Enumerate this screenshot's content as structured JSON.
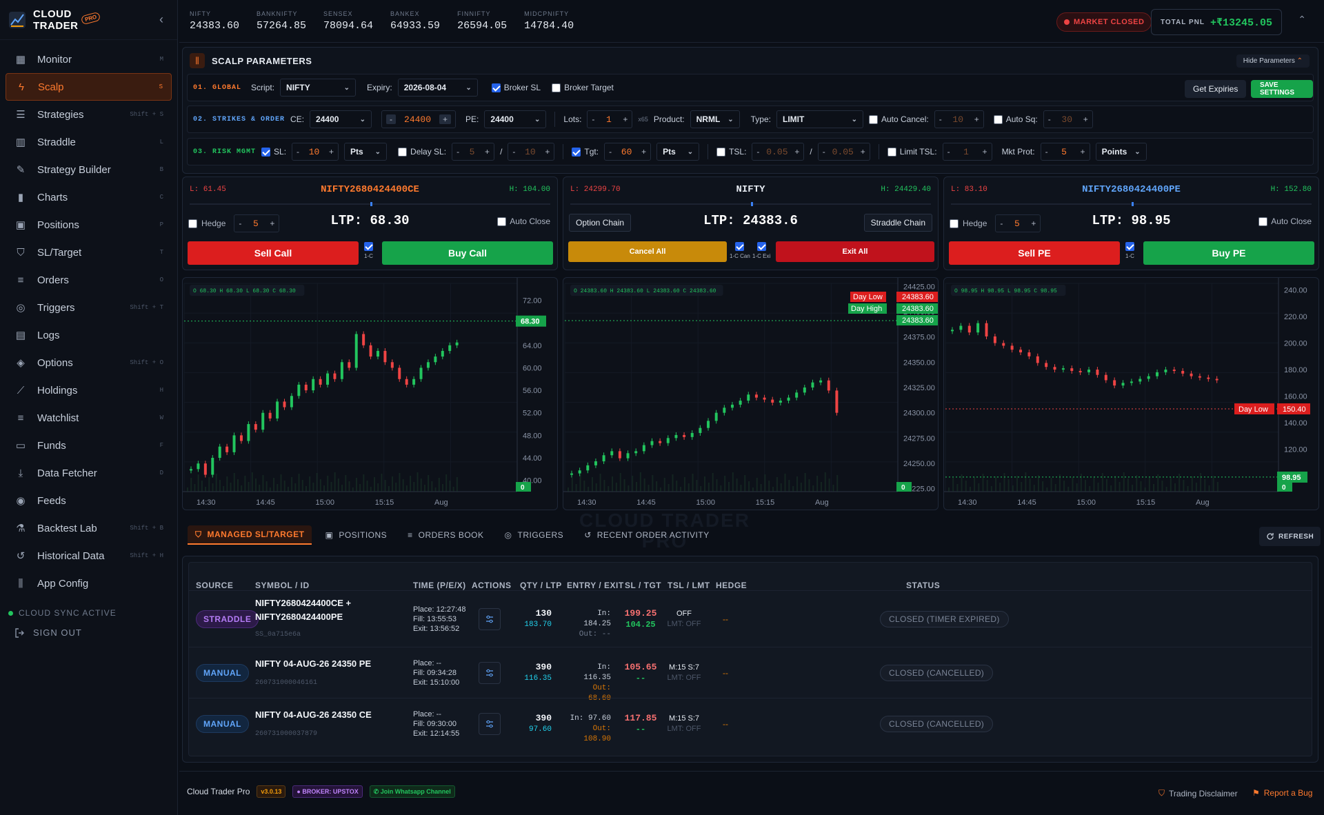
{
  "brand": {
    "name_line1": "CLOUD",
    "name_line2": "TRADER",
    "badge": "PRO"
  },
  "nav": [
    {
      "label": "Monitor",
      "shortcut": "M",
      "icon": "grid-icon"
    },
    {
      "label": "Scalp",
      "shortcut": "S",
      "icon": "bolt-icon",
      "active": true
    },
    {
      "label": "Strategies",
      "shortcut": "Shift + S",
      "icon": "layers-icon"
    },
    {
      "label": "Straddle",
      "shortcut": "L",
      "icon": "columns-icon"
    },
    {
      "label": "Strategy Builder",
      "shortcut": "B",
      "icon": "wrench-icon"
    },
    {
      "label": "Charts",
      "shortcut": "C",
      "icon": "bar-chart-icon"
    },
    {
      "label": "Positions",
      "shortcut": "P",
      "icon": "briefcase-icon"
    },
    {
      "label": "SL/Target",
      "shortcut": "T",
      "icon": "shield-icon"
    },
    {
      "label": "Orders",
      "shortcut": "O",
      "icon": "list-icon"
    },
    {
      "label": "Triggers",
      "shortcut": "Shift + T",
      "icon": "target-icon"
    },
    {
      "label": "Logs",
      "shortcut": "",
      "icon": "file-icon"
    },
    {
      "label": "Options",
      "shortcut": "Shift + O",
      "icon": "stack-icon"
    },
    {
      "label": "Holdings",
      "shortcut": "H",
      "icon": "line-chart-icon"
    },
    {
      "label": "Watchlist",
      "shortcut": "W",
      "icon": "list-icon"
    },
    {
      "label": "Funds",
      "shortcut": "F",
      "icon": "wallet-icon"
    },
    {
      "label": "Data Fetcher",
      "shortcut": "D",
      "icon": "download-icon"
    },
    {
      "label": "Feeds",
      "shortcut": "",
      "icon": "broadcast-icon"
    },
    {
      "label": "Backtest Lab",
      "shortcut": "Shift + B",
      "icon": "flask-icon"
    },
    {
      "label": "Historical Data",
      "shortcut": "Shift + H",
      "icon": "history-icon"
    },
    {
      "label": "App Config",
      "shortcut": "",
      "icon": "sliders-icon"
    }
  ],
  "sync_label": "CLOUD SYNC ACTIVE",
  "signout_label": "SIGN OUT",
  "indices": [
    {
      "name": "NIFTY",
      "value": "24383.60"
    },
    {
      "name": "BANKNIFTY",
      "value": "57264.85"
    },
    {
      "name": "SENSEX",
      "value": "78094.64"
    },
    {
      "name": "BANKEX",
      "value": "64933.59"
    },
    {
      "name": "FINNIFTY",
      "value": "26594.05"
    },
    {
      "name": "MIDCPNIFTY",
      "value": "14784.40"
    }
  ],
  "market_status": "MARKET CLOSED",
  "pnl": {
    "label": "TOTAL PNL",
    "value": "+₹13245.05"
  },
  "params": {
    "title": "SCALP PARAMETERS",
    "hide_label": "Hide Parameters",
    "global": {
      "section": "01. GLOBAL",
      "script_label": "Script:",
      "script": "NIFTY",
      "expiry_label": "Expiry:",
      "expiry": "2026-08-04",
      "broker_sl": "Broker SL",
      "broker_target": "Broker Target",
      "get_expiries": "Get Expiries",
      "save": "SAVE SETTINGS"
    },
    "strikes": {
      "section": "02. STRIKES & ORDER",
      "ce_label": "CE:",
      "ce": "24400",
      "mid_strike": "24400",
      "pe_label": "PE:",
      "pe": "24400",
      "lots_label": "Lots:",
      "lots": "1",
      "lot_mult": "x65",
      "product_label": "Product:",
      "product": "NRML",
      "type_label": "Type:",
      "type": "LIMIT",
      "auto_cancel": "Auto Cancel:",
      "auto_cancel_val": "10",
      "auto_sq": "Auto Sq:",
      "auto_sq_val": "30"
    },
    "risk": {
      "section": "03. RISK MGMT",
      "sl_label": "SL:",
      "sl": "10",
      "sl_unit": "Pts",
      "delay_label": "Delay SL:",
      "delay1": "5",
      "delay_sep": "/",
      "delay2": "10",
      "tgt_label": "Tgt:",
      "tgt": "60",
      "tgt_unit": "Pts",
      "tsl_label": "TSL:",
      "tsl1": "0.05",
      "tsl_sep": "/",
      "tsl2": "0.05",
      "limit_tsl": "Limit TSL:",
      "limit_tsl_val": "1",
      "mkt_prot": "Mkt Prot:",
      "mkt_prot_val": "5",
      "mkt_prot_unit": "Points"
    }
  },
  "panels": {
    "ce": {
      "low": "L: 61.45",
      "high": "H: 104.00",
      "symbol": "NIFTY2680424400CE",
      "ltp": "LTP: 68.30",
      "hedge": "Hedge",
      "hedge_val": "5",
      "auto_close": "Auto Close",
      "sell": "Sell Call",
      "buy": "Buy Call",
      "onec": "1-C",
      "marker_fraction": 0.5
    },
    "mid": {
      "low": "L: 24299.70",
      "high": "H: 24429.40",
      "symbol": "NIFTY",
      "ltp": "LTP: 24383.6",
      "option_chain": "Option Chain",
      "straddle_chain": "Straddle Chain",
      "cancel_all": "Cancel All",
      "exit_all": "Exit All",
      "can1c": "1-C Can",
      "exi1c": "1-C Exi",
      "marker_fraction": 0.5
    },
    "pe": {
      "low": "L: 83.10",
      "high": "H: 152.80",
      "symbol": "NIFTY2680424400PE",
      "ltp": "LTP: 98.95",
      "hedge": "Hedge",
      "hedge_val": "5",
      "auto_close": "Auto Close",
      "sell": "Sell PE",
      "buy": "Buy PE",
      "onec": "1-C",
      "marker_fraction": 0.5
    }
  },
  "chart_data": [
    {
      "type": "line",
      "title": "",
      "ohlc_label": "O 68.30  H 68.30  L 68.30  C 68.30",
      "x_ticks": [
        "14:30",
        "14:45",
        "15:00",
        "15:15",
        "Aug"
      ],
      "y_ticks": [
        "72.00",
        "68.30",
        "64.00",
        "60.00",
        "56.00",
        "52.00",
        "48.00",
        "44.00",
        "40.00"
      ],
      "ylim": [
        38,
        75
      ],
      "last_label": "68.30",
      "zero_label": "0",
      "values": [
        42,
        43,
        41,
        44,
        46,
        45,
        48,
        47,
        50,
        49,
        52,
        51,
        54,
        53,
        55,
        57,
        56,
        58,
        57,
        59,
        58,
        61,
        60,
        66,
        64,
        62,
        63,
        61,
        60,
        58,
        57,
        58,
        60,
        61,
        62,
        63,
        64,
        64.5
      ]
    },
    {
      "type": "line",
      "title": "",
      "ohlc_label": "O 24383.60  H 24383.60  L 24383.60  C 24383.60",
      "x_ticks": [
        "14:30",
        "14:45",
        "15:00",
        "15:15",
        "Aug"
      ],
      "y_ticks": [
        "24425.00",
        "24400.00",
        "24375.00",
        "24350.00",
        "24325.00",
        "24300.00",
        "24275.00",
        "24250.00",
        "24225.00"
      ],
      "ylim": [
        24222,
        24428
      ],
      "day_low_label": "Day Low",
      "day_high_label": "Day High",
      "price_tags": [
        "24383.60",
        "24383.60",
        "24383.60"
      ],
      "zero_label": "0",
      "values": [
        24240,
        24243,
        24248,
        24252,
        24258,
        24262,
        24255,
        24260,
        24262,
        24268,
        24272,
        24270,
        24275,
        24278,
        24276,
        24280,
        24285,
        24292,
        24300,
        24305,
        24308,
        24312,
        24318,
        24315,
        24313,
        24310,
        24312,
        24315,
        24320,
        24325,
        24330,
        24332,
        24322,
        24300
      ]
    },
    {
      "type": "line",
      "title": "",
      "ohlc_label": "O 98.95  H 98.95  L 98.95  C 98.95",
      "x_ticks": [
        "14:30",
        "14:45",
        "15:00",
        "15:15",
        "Aug"
      ],
      "y_ticks": [
        "240.00",
        "220.00",
        "200.00",
        "180.00",
        "160.00",
        "140.00",
        "120.00",
        "100.00"
      ],
      "ylim": [
        88,
        245
      ],
      "day_low_label": "Day Low",
      "day_low_value": "150.40",
      "last_label": "98.95",
      "zero_label": "0",
      "values": [
        210,
        213,
        208,
        215,
        205,
        200,
        198,
        195,
        193,
        190,
        185,
        182,
        180,
        181,
        179,
        178,
        180,
        176,
        172,
        168,
        170,
        171,
        173,
        175,
        178,
        180,
        179,
        177,
        175,
        174,
        173,
        172
      ]
    }
  ],
  "tabs": [
    {
      "label": "MANAGED SL/TARGET",
      "icon": "shield-icon",
      "active": true
    },
    {
      "label": "POSITIONS",
      "icon": "briefcase-icon"
    },
    {
      "label": "ORDERS BOOK",
      "icon": "list-icon"
    },
    {
      "label": "TRIGGERS",
      "icon": "target-icon"
    },
    {
      "label": "RECENT ORDER ACTIVITY",
      "icon": "history-icon"
    }
  ],
  "refresh_label": "REFRESH",
  "watermark": [
    "CLOUD TRADER",
    "PRO"
  ],
  "table": {
    "headers": [
      "SOURCE",
      "SYMBOL / ID",
      "TIME (P/E/X)",
      "ACTIONS",
      "QTY / LTP",
      "ENTRY / EXIT",
      "SL / TGT",
      "TSL / LMT",
      "HEDGE",
      "STATUS"
    ],
    "rows": [
      {
        "source": "STRADDLE",
        "symbol": "NIFTY2680424400CE +",
        "symbol2": "NIFTY2680424400PE",
        "id": "SS_0a715e6a",
        "place": "Place: 12:27:48",
        "fill": "Fill: 13:55:53",
        "exit": "Exit: 13:56:52",
        "qty": "130",
        "ltp": "183.70",
        "in": "In: 184.25",
        "out": "Out: --",
        "sl": "199.25",
        "tgt": "104.25",
        "tsl": "OFF",
        "lmt": "LMT: OFF",
        "hedge": "--",
        "status": "CLOSED (TIMER EXPIRED)"
      },
      {
        "source": "MANUAL",
        "symbol": "NIFTY 04-AUG-26 24350 PE",
        "symbol2": "",
        "id": "260731000046161",
        "place": "Place: --",
        "fill": "Fill: 09:34:28",
        "exit": "Exit: 15:10:00",
        "qty": "390",
        "ltp": "116.35",
        "in": "In: 116.35",
        "out": "Out: 68.60",
        "sl": "105.65",
        "tgt": "--",
        "tsl": "M:15 S:7",
        "lmt": "LMT: OFF",
        "hedge": "--",
        "status": "CLOSED (CANCELLED)"
      },
      {
        "source": "MANUAL",
        "symbol": "NIFTY 04-AUG-26 24350 CE",
        "symbol2": "",
        "id": "260731000037879",
        "place": "Place: --",
        "fill": "Fill: 09:30:00",
        "exit": "Exit: 12:14:55",
        "qty": "390",
        "ltp": "97.60",
        "in": "In: 97.60",
        "out": "Out: 108.90",
        "sl": "117.85",
        "tgt": "--",
        "tsl": "M:15 S:7",
        "lmt": "LMT: OFF",
        "hedge": "--",
        "status": "CLOSED (CANCELLED)"
      }
    ]
  },
  "footer": {
    "app": "Cloud Trader Pro",
    "version": "v3.0.13",
    "broker": "● BROKER: UPSTOX",
    "whatsapp": "Join Whatsapp Channel",
    "disclaimer": "Trading Disclaimer",
    "bug": "Report a Bug"
  },
  "colors": {
    "accent": "#ff7a2e",
    "green": "#16a34a",
    "red": "#dc1e1e",
    "bg": "#0b0f17"
  }
}
